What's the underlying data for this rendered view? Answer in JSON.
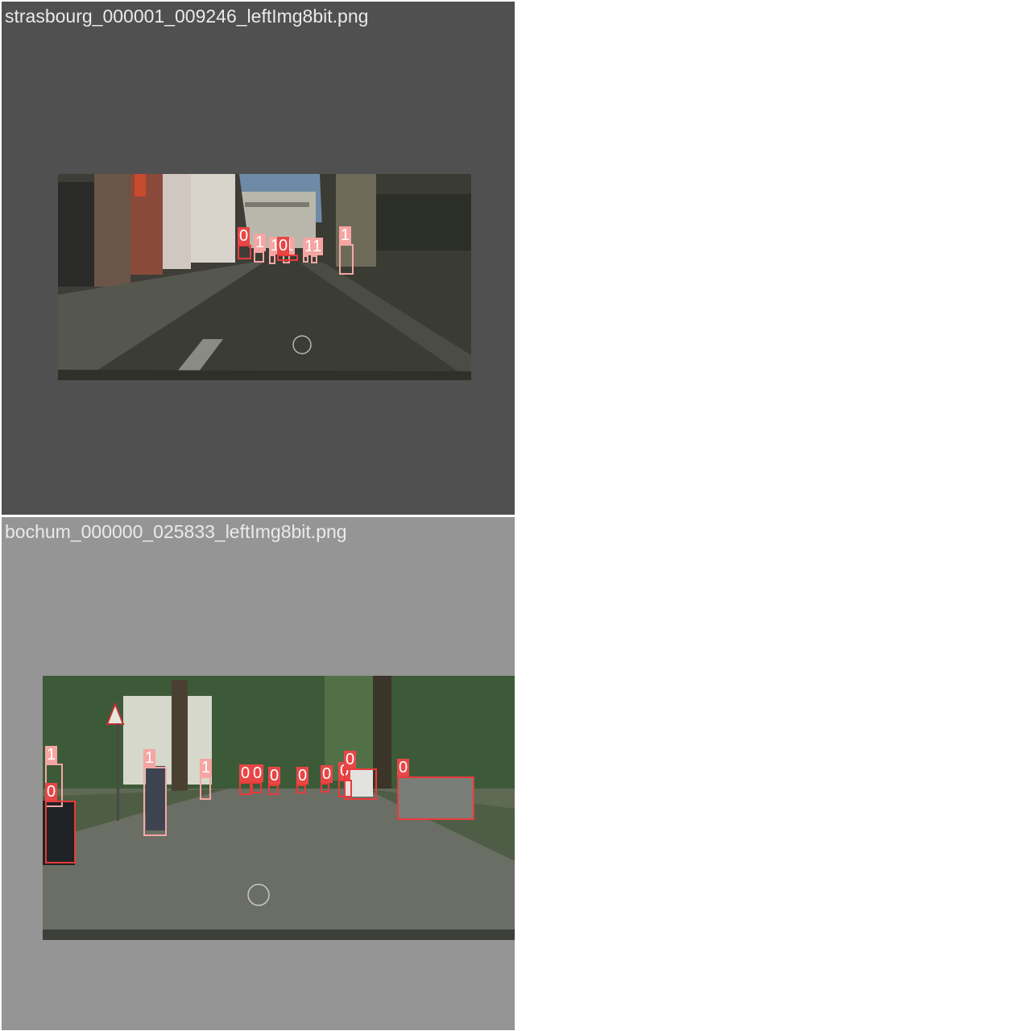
{
  "classes": {
    "0": {
      "color": "#ea3a3a",
      "label_bg": "#e84646"
    },
    "1": {
      "color": "#f5a7a4",
      "label_bg": "#f5a5a2"
    }
  },
  "tiles": [
    {
      "filename": "strasbourg_000001_009246_leftImg8bit.png",
      "detections": [
        {
          "cls": "0",
          "label": "0"
        },
        {
          "cls": "1",
          "label": "1"
        },
        {
          "cls": "1",
          "label": "1"
        },
        {
          "cls": "1",
          "label": "1"
        },
        {
          "cls": "0",
          "label": "0"
        },
        {
          "cls": "1",
          "label": "1"
        },
        {
          "cls": "1",
          "label": "1"
        },
        {
          "cls": "1",
          "label": "1"
        }
      ]
    },
    {
      "filename": "bochum_000000_025833_leftImg8bit.png",
      "detections": [
        {
          "cls": "1",
          "label": "1"
        },
        {
          "cls": "0",
          "label": "0"
        },
        {
          "cls": "1",
          "label": "1"
        },
        {
          "cls": "1",
          "label": "1"
        },
        {
          "cls": "0",
          "label": "0"
        },
        {
          "cls": "0",
          "label": "0"
        },
        {
          "cls": "0",
          "label": "0"
        },
        {
          "cls": "0",
          "label": "0"
        },
        {
          "cls": "0",
          "label": "0"
        },
        {
          "cls": "0",
          "label": "0"
        },
        {
          "cls": "0",
          "label": "0"
        },
        {
          "cls": "0",
          "label": "0"
        }
      ]
    }
  ]
}
